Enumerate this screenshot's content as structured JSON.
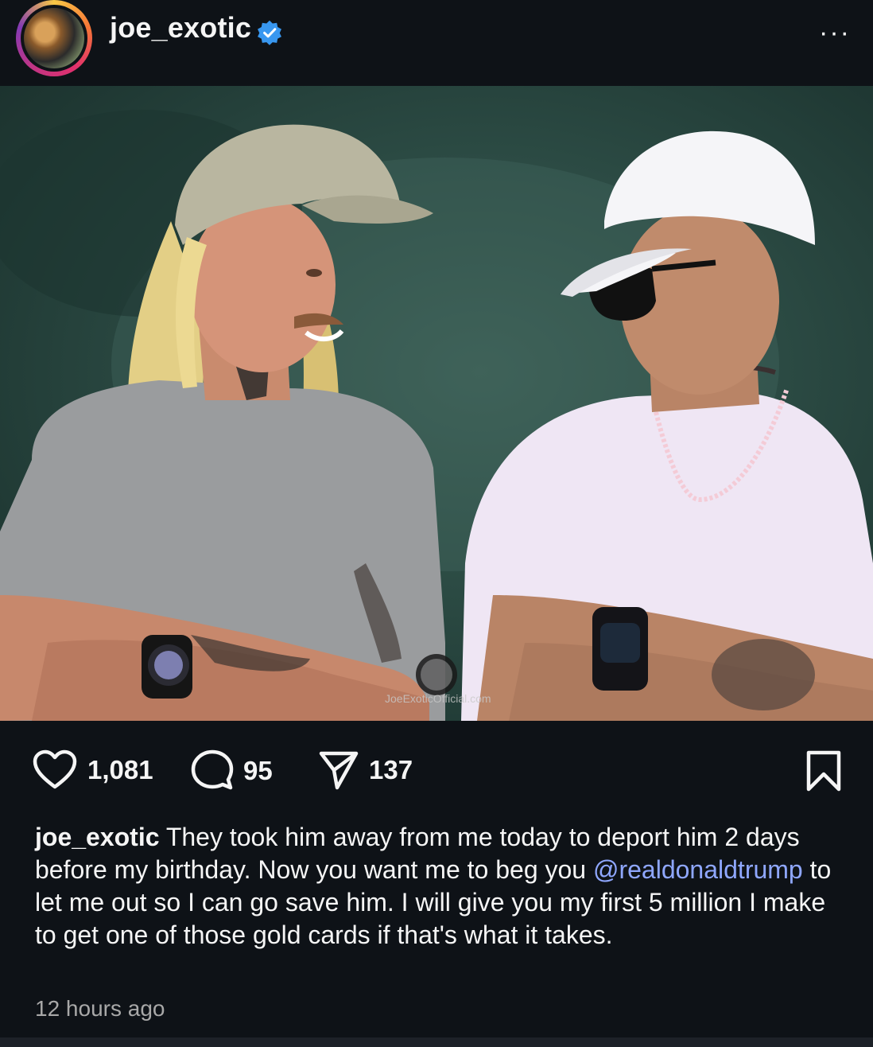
{
  "header": {
    "username": "joe_exotic",
    "verified": true,
    "avatar_icon": "profile-avatar",
    "more_label": "···"
  },
  "photo": {
    "watermark": "JoeExoticOfficial.com"
  },
  "actions": {
    "likes": "1,081",
    "comments": "95",
    "shares": "137",
    "icons": [
      "heart-icon",
      "comment-icon",
      "share-icon",
      "bookmark-icon"
    ]
  },
  "caption": {
    "username": "joe_exotic",
    "text_1": " They took him away from me today to deport him 2 days before my birthday.  Now you want me to beg you ",
    "mention": "@realdonaldtrump",
    "text_2": " to let me out so I can go save him. I will give you my first 5 million I make to get one of those gold cards if that's what it takes."
  },
  "timestamp": "12 hours ago",
  "colors": {
    "background": "#0e1217",
    "mention": "#8fa7ff",
    "verified_badge": "#3897f0",
    "muted_text": "#a8a8a8"
  }
}
